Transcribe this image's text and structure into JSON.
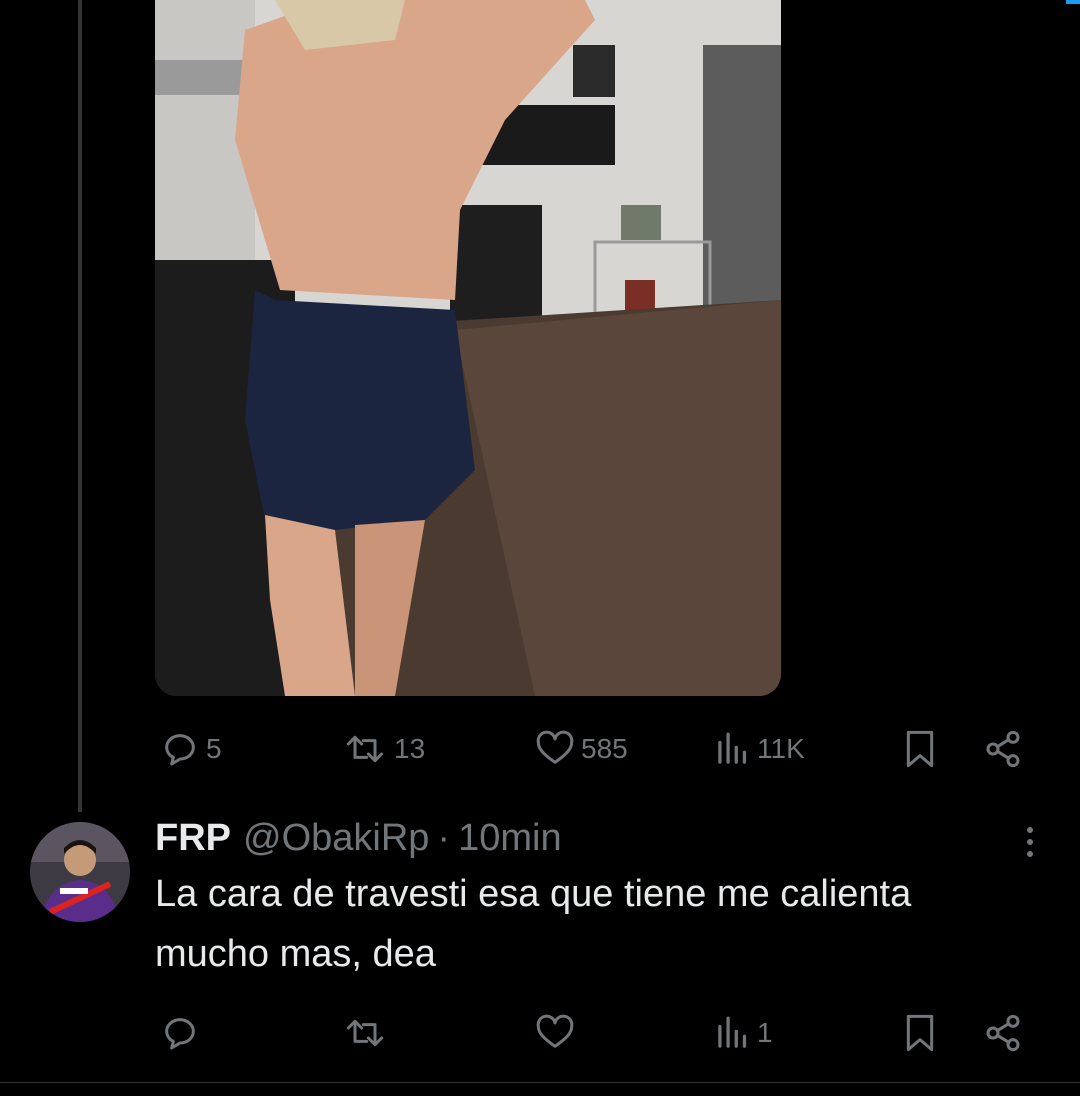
{
  "tweet": {
    "stats": {
      "replies": "5",
      "reposts": "13",
      "likes": "585",
      "views": "11K"
    }
  },
  "reply": {
    "name": "FRP",
    "handle": "@ObakiRp",
    "separator": "·",
    "time": "10min",
    "text": "La cara de travesti esa que tiene me calienta mucho mas, dea",
    "stats": {
      "replies": "",
      "reposts": "",
      "likes": "",
      "views": "1"
    }
  },
  "icons": {
    "reply": "speech-bubble-icon",
    "repost": "repost-arrows-icon",
    "like": "heart-icon",
    "views": "bar-chart-icon",
    "bookmark": "bookmark-icon",
    "share": "share-icon",
    "sound": "speaker-icon",
    "more": "vertical-dots-icon"
  },
  "colors": {
    "background": "#000000",
    "text": "#e7e9ea",
    "muted": "#71767b",
    "accent": "#1d9bf0"
  }
}
